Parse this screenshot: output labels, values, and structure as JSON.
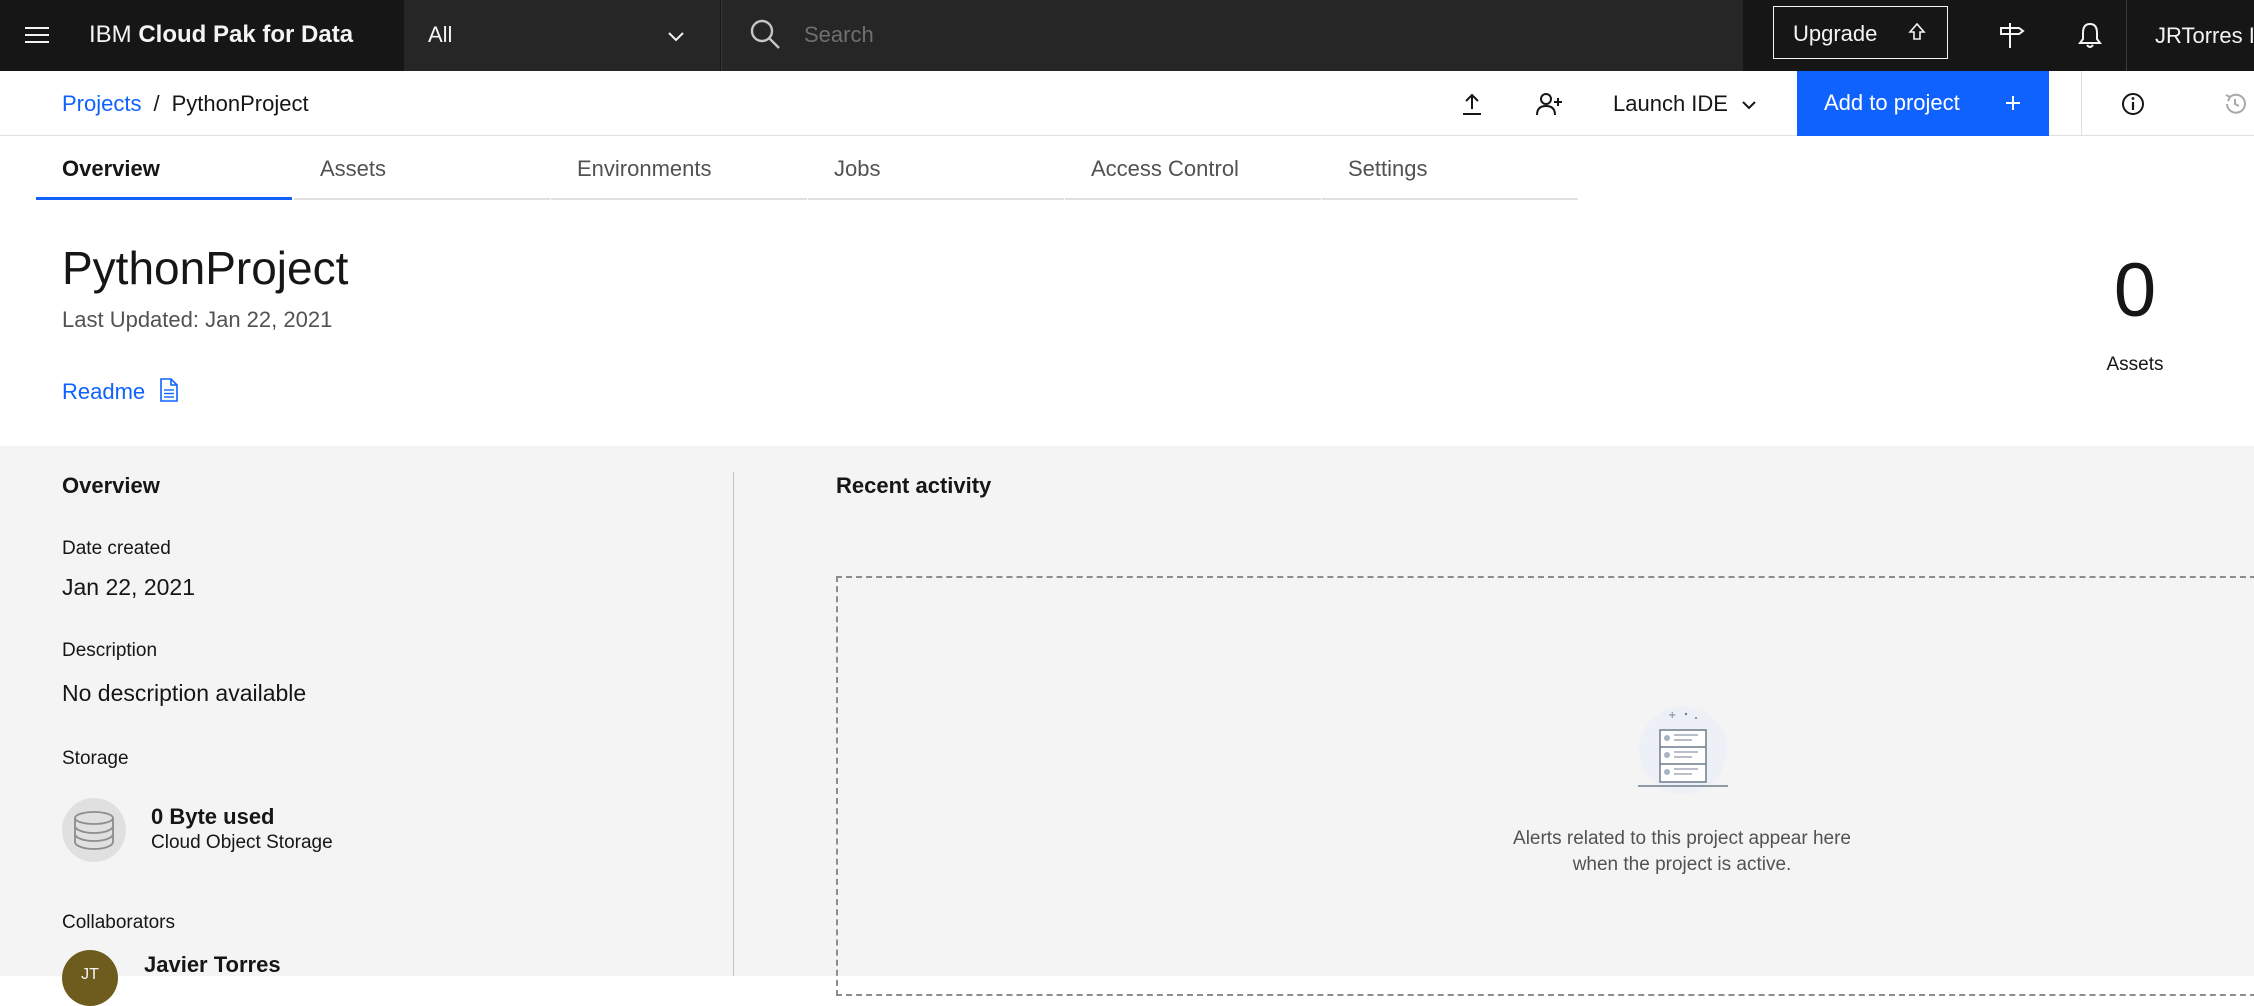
{
  "topbar": {
    "brand_prefix": "IBM",
    "brand_bold": "Cloud Pak for Data",
    "scope": "All",
    "search_placeholder": "Search",
    "upgrade_label": "Upgrade",
    "user": "JRTorres I",
    "icons": [
      "menu-icon",
      "chevron-down-icon",
      "search-icon",
      "upgrade-arrow-icon",
      "signpost-icon",
      "notification-bell-icon"
    ]
  },
  "subheader": {
    "breadcrumb": {
      "parent": "Projects",
      "separator": "/",
      "current": "PythonProject"
    },
    "launch_ide": "Launch IDE",
    "add_to_project": "Add to project",
    "icons": [
      "upload-icon",
      "add-collaborator-icon",
      "info-icon",
      "history-icon"
    ]
  },
  "tabs": [
    "Overview",
    "Assets",
    "Environments",
    "Jobs",
    "Access Control",
    "Settings"
  ],
  "active_tab": "Overview",
  "project": {
    "title": "PythonProject",
    "last_updated": "Last Updated: Jan 22, 2021",
    "readme": "Readme",
    "assets_count": "0",
    "assets_label": "Assets"
  },
  "overview": {
    "heading": "Overview",
    "date_created_label": "Date created",
    "date_created": "Jan 22, 2021",
    "description_label": "Description",
    "description": "No description available",
    "storage_label": "Storage",
    "storage_used": "0 Byte used",
    "storage_type": "Cloud Object Storage",
    "collaborators_label": "Collaborators",
    "collaborator_initials": "JT",
    "collaborator_name": "Javier Torres"
  },
  "activity": {
    "heading": "Recent activity",
    "empty_line1": "Alerts related to this project appear here",
    "empty_line2": "when the project is active."
  },
  "colors": {
    "topbar": "#161616",
    "accent": "#0f62fe",
    "panel": "#f4f4f4",
    "avatar": "#6e5b1e"
  }
}
